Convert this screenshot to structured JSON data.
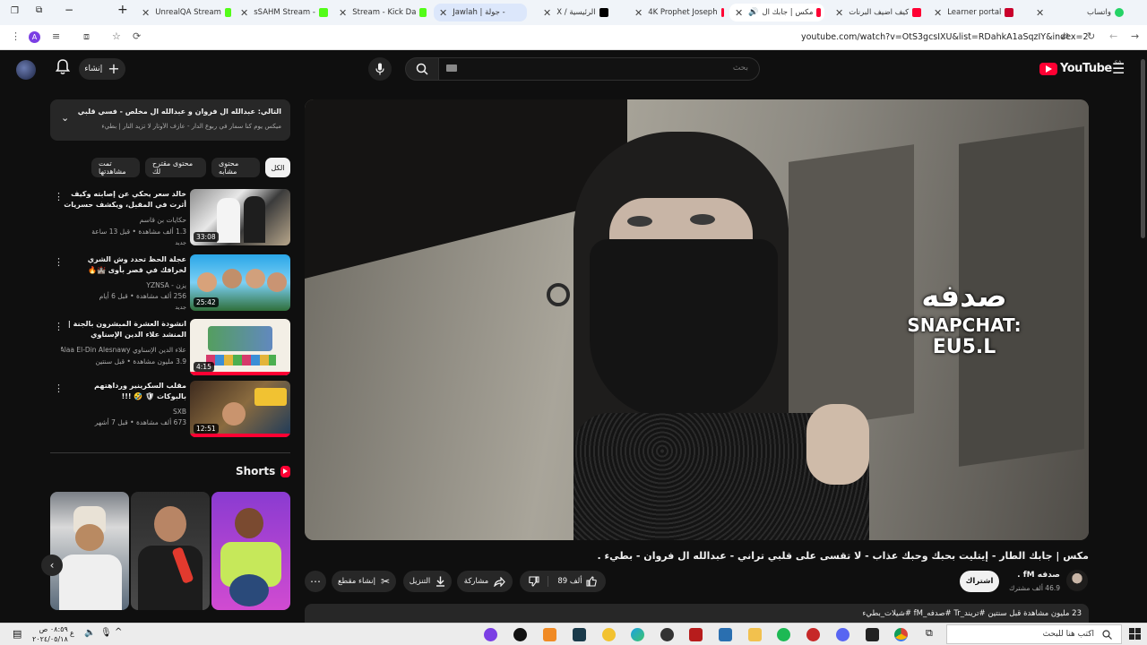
{
  "browser": {
    "tabs": [
      {
        "label": "UnrealQA Stream"
      },
      {
        "label": "sSAHM Stream -"
      },
      {
        "label": "Stream - Kick Da"
      },
      {
        "label": "Jawlah | جولة -"
      },
      {
        "label": "X / الرئيسية"
      },
      {
        "label": "4K Prophet Joseph"
      },
      {
        "label": "مكس | جابك ال"
      },
      {
        "label": "كيف اضيف البرنات"
      },
      {
        "label": "Learner portal"
      },
      {
        "label": "واتساب"
      }
    ],
    "url": "youtube.com/watch?v=OtS3gcsIXU&list=RDahkA1aSqzIY&index=2"
  },
  "header": {
    "create_label": "إنشاء",
    "search_placeholder": "بحث",
    "logo_text": "YouTube",
    "logo_region": "SA"
  },
  "playlist": {
    "title": "التالي: عبدالله ال فروان و عبدالله ال مخلص - فسي قلبي (حسرين) | 2023",
    "subtitle": "ميكس يوم كنا سمار في ربوع الدار - عازف الأوتار لا تزيد النار | بطيء"
  },
  "chips": [
    {
      "label": "الكل"
    },
    {
      "label": "محتوى مشابه"
    },
    {
      "label": "محتوى مقترح لك"
    },
    {
      "label": "تمت مشاهدتها"
    }
  ],
  "recommendations": [
    {
      "title": "خالد سعر يحكي عن إصابته وكيف أثرت في المقبل، ويكشف حسريات شارع الأعشى ...",
      "channel": "حكايات بن قاسم",
      "meta": "1.3 ألف مشاهدة • قبل 13 ساعة",
      "badge": "جديد",
      "duration": "33:08"
    },
    {
      "title": "عجلة الحظ تحدد وش الشري لخرافك في قصر بأوى 🏰🔥",
      "channel": "يزن - YZNSA",
      "meta": "256 ألف مشاهدة • قبل 6 أيام",
      "badge": "جديد",
      "duration": "25:42"
    },
    {
      "title": "انشودة العشرة المبشرون بالجنة | المنشد علاء الدين الإسناوي",
      "channel": "علاء الدين الإسناوي Alaa El-Din Alesnawy",
      "meta": "3.9 مليون مشاهدة • قبل سنتين",
      "badge": "",
      "duration": "4:15"
    },
    {
      "title": "مقلب السكرينير ورداهتهم بالبوكات 🛡 🤣 !!!",
      "channel": "SXB",
      "meta": "673 ألف مشاهدة • قبل 7 أشهر",
      "badge": "",
      "duration": "12:51"
    }
  ],
  "shorts": {
    "heading": "Shorts"
  },
  "video": {
    "title": "مكس | جابك الطار - إيتليت بحبك وحبك عذاب - لا تقسى على قلبي تراني - عبدالله ال فروان - بطيء .",
    "overlay_line1": "صدفه",
    "overlay_line2": "SNAPCHAT:",
    "overlay_line3": "EU5.L",
    "channel_name": "صدفه fM .",
    "subscribers": "46.9 ألف مشترك",
    "subscribe_label": "اشتراك",
    "like_count": "89 ألف",
    "share_label": "مشاركة",
    "download_label": "التنزيل",
    "clip_label": "إنشاء مقطع",
    "description_line": "23 مليون مشاهدة قبل سنتين #تريند_Tr #صدفه_fM #شيلات_بطيء"
  },
  "taskbar": {
    "search_placeholder": "اكتب هنا للبحث",
    "time": "٠٨:٥٩ ص",
    "date": "٢٠٢٤/٠٥/١٨"
  }
}
